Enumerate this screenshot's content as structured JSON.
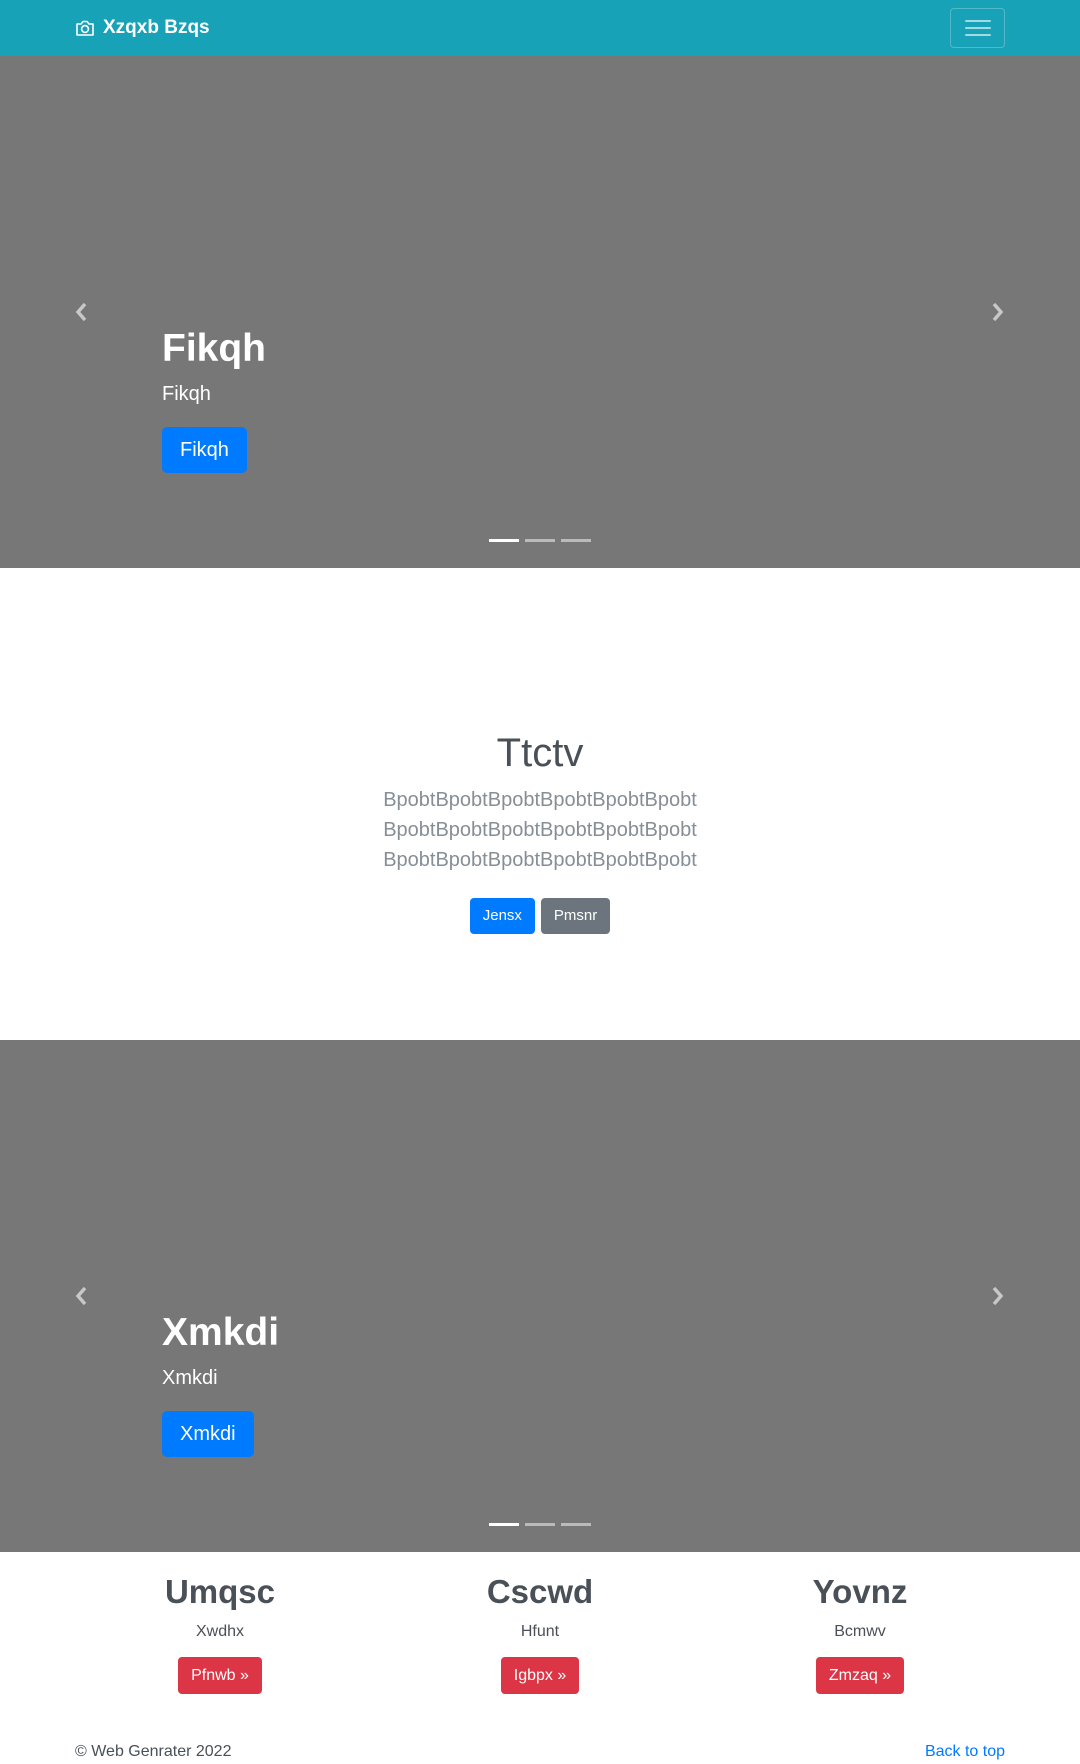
{
  "navbar": {
    "brand_icon": "camera-icon",
    "brand": "Xzqxb Bzqs",
    "toggler_icon": "hamburger-icon",
    "background": "#17a2b8"
  },
  "carousel1": {
    "heading": "Fikqh",
    "subtext": "Fikqh",
    "button": "Fikqh",
    "indicator_count": 3,
    "active_indicator": 1
  },
  "jumbotron": {
    "heading": "Ttctv",
    "lead": "BpobtBpobtBpobtBpobtBpobtBpobtBpobtBpobtBpobtBpobtBpobtBpobtBpobtBpobtBpobtBpobtBpobtBpobt",
    "primary_button": "Jensx",
    "secondary_button": "Pmsnr"
  },
  "carousel2": {
    "heading": "Xmkdi",
    "subtext": "Xmkdi",
    "button": "Xmkdi",
    "indicator_count": 3,
    "active_indicator": 1
  },
  "columns": [
    {
      "heading": "Umqsc",
      "text": "Xwdhx",
      "button": "Pfnwb »"
    },
    {
      "heading": "Cscwd",
      "text": "Hfunt",
      "button": "Igbpx »"
    },
    {
      "heading": "Yovnz",
      "text": "Bcmwv",
      "button": "Zmzaq »"
    }
  ],
  "footer": {
    "copyright": "© Web Genrater 2022",
    "back_to_top": "Back to top"
  },
  "colors": {
    "carousel_bg": "#777777",
    "primary": "#007bff",
    "secondary": "#6c757d",
    "danger": "#dc3545"
  }
}
